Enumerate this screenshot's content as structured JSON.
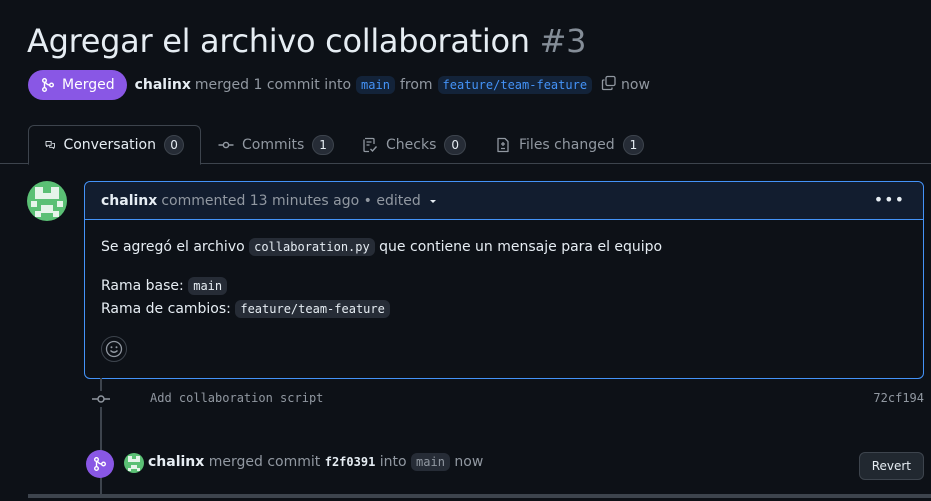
{
  "pr": {
    "title": "Agregar el archivo collaboration",
    "number": "#3",
    "status": "Merged",
    "author": "chalinx",
    "action_text": "merged 1 commit into",
    "base_branch": "main",
    "from_text": "from",
    "head_branch": "feature/team-feature",
    "time": "now"
  },
  "tabs": [
    {
      "label": "Conversation",
      "count": "0",
      "icon": "comment-discussion-icon"
    },
    {
      "label": "Commits",
      "count": "1",
      "icon": "git-commit-icon"
    },
    {
      "label": "Checks",
      "count": "0",
      "icon": "checklist-icon"
    },
    {
      "label": "Files changed",
      "count": "1",
      "icon": "file-diff-icon"
    }
  ],
  "comment": {
    "author": "chalinx",
    "meta": "commented 13 minutes ago • edited",
    "line1_prefix": "Se agregó el archivo",
    "line1_code": "collaboration.py",
    "line1_suffix": "que contiene un mensaje para el equipo",
    "line2_label": "Rama base:",
    "line2_code": "main",
    "line3_label": "Rama de cambios:",
    "line3_code": "feature/team-feature"
  },
  "commit": {
    "message": "Add collaboration script",
    "sha": "72cf194"
  },
  "merge_event": {
    "author": "chalinx",
    "text": "merged commit",
    "sha": "f2f0391",
    "into_text": "into",
    "branch": "main",
    "time": "now",
    "revert_label": "Revert"
  },
  "colors": {
    "merged": "#8957e5",
    "link": "#4493f8",
    "background": "#0d1117"
  }
}
